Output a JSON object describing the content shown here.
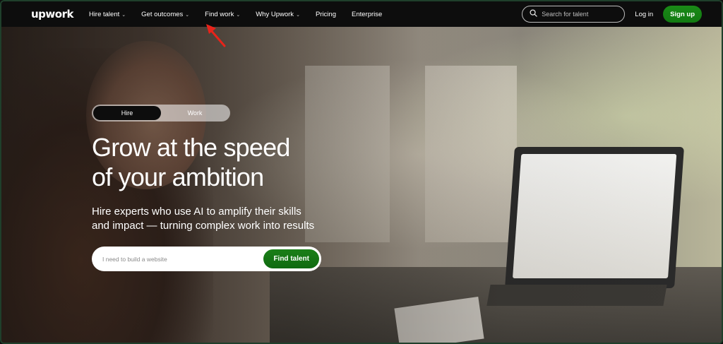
{
  "nav": {
    "logo": "upwork",
    "items": [
      {
        "label": "Hire talent",
        "chevron": true
      },
      {
        "label": "Get outcomes",
        "chevron": true
      },
      {
        "label": "Find work",
        "chevron": true
      },
      {
        "label": "Why Upwork",
        "chevron": true
      },
      {
        "label": "Pricing",
        "chevron": false
      },
      {
        "label": "Enterprise",
        "chevron": false
      }
    ],
    "search_placeholder": "Search for talent",
    "login": "Log in",
    "signup": "Sign up"
  },
  "hero": {
    "toggle": {
      "hire": "Hire",
      "work": "Work",
      "selected": "Hire"
    },
    "headline_line1": "Grow at the speed",
    "headline_line2": "of your ambition",
    "subline_line1": "Hire experts who use AI to amplify their skills",
    "subline_line2": "and impact — turning complex work into results",
    "search_placeholder": "I need to build a website",
    "cta": "Find talent"
  },
  "colors": {
    "brand_green": "#14a800",
    "nav_bg": "#0d0d0d",
    "annotation_arrow": "#e8231a"
  },
  "icons": [
    "search-icon",
    "chevron-down-icon",
    "annotation-arrow-icon"
  ]
}
